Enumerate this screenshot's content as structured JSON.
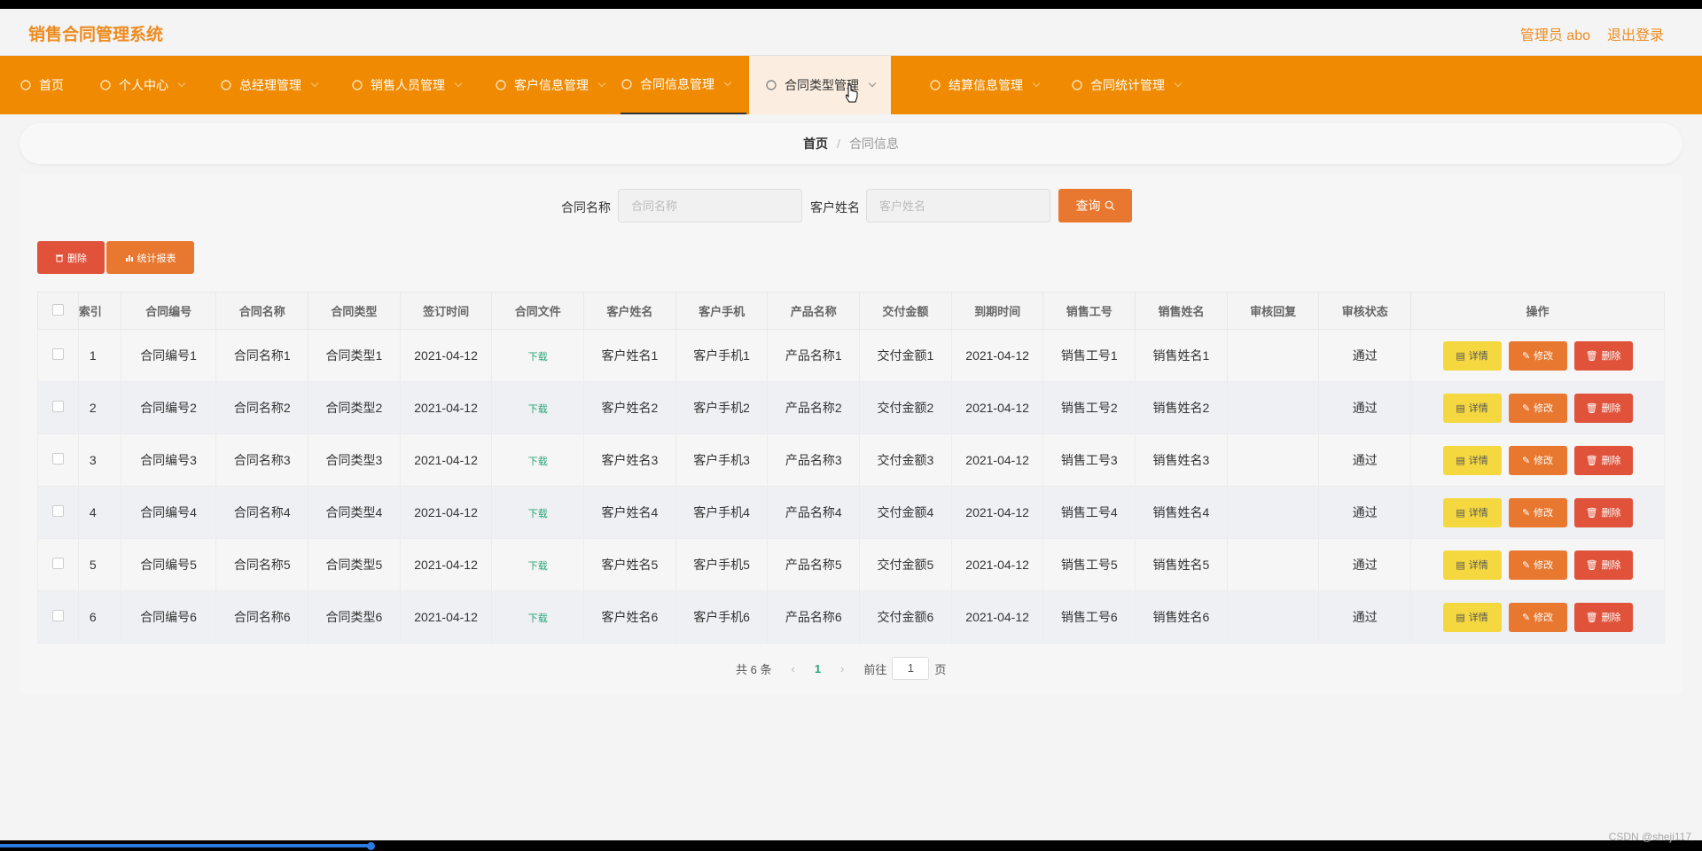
{
  "header": {
    "app_title": "销售合同管理系统",
    "admin_label": "管理员 abo",
    "logout_label": "退出登录"
  },
  "nav": {
    "items": [
      {
        "label": "首页"
      },
      {
        "label": "个人中心"
      },
      {
        "label": "总经理管理"
      },
      {
        "label": "销售人员管理"
      },
      {
        "label": "客户信息管理"
      },
      {
        "label": "合同信息管理"
      },
      {
        "label": "合同类型管理"
      },
      {
        "label": "结算信息管理"
      },
      {
        "label": "合同统计管理"
      }
    ]
  },
  "breadcrumb": {
    "home": "首页",
    "separator": "/",
    "current": "合同信息"
  },
  "search": {
    "contract_name_label": "合同名称",
    "contract_name_placeholder": "合同名称",
    "customer_name_label": "客户姓名",
    "customer_name_placeholder": "客户姓名",
    "query_label": "查询"
  },
  "actions": {
    "delete_label": "删除",
    "stats_label": "统计报表"
  },
  "table": {
    "headers": [
      "索引",
      "合同编号",
      "合同名称",
      "合同类型",
      "签订时间",
      "合同文件",
      "客户姓名",
      "客户手机",
      "产品名称",
      "交付金额",
      "到期时间",
      "销售工号",
      "销售姓名",
      "审核回复",
      "审核状态",
      "操作"
    ],
    "download_label": "下载",
    "op_detail": "详情",
    "op_edit": "修改",
    "op_delete": "删除",
    "rows": [
      {
        "idx": "1",
        "code": "合同编号1",
        "name": "合同名称1",
        "type": "合同类型1",
        "sign": "2021-04-12",
        "cust": "客户姓名1",
        "phone": "客户手机1",
        "product": "产品名称1",
        "amount": "交付金额1",
        "due": "2021-04-12",
        "sno": "销售工号1",
        "sname": "销售姓名1",
        "reply": "",
        "status": "通过"
      },
      {
        "idx": "2",
        "code": "合同编号2",
        "name": "合同名称2",
        "type": "合同类型2",
        "sign": "2021-04-12",
        "cust": "客户姓名2",
        "phone": "客户手机2",
        "product": "产品名称2",
        "amount": "交付金额2",
        "due": "2021-04-12",
        "sno": "销售工号2",
        "sname": "销售姓名2",
        "reply": "",
        "status": "通过"
      },
      {
        "idx": "3",
        "code": "合同编号3",
        "name": "合同名称3",
        "type": "合同类型3",
        "sign": "2021-04-12",
        "cust": "客户姓名3",
        "phone": "客户手机3",
        "product": "产品名称3",
        "amount": "交付金额3",
        "due": "2021-04-12",
        "sno": "销售工号3",
        "sname": "销售姓名3",
        "reply": "",
        "status": "通过"
      },
      {
        "idx": "4",
        "code": "合同编号4",
        "name": "合同名称4",
        "type": "合同类型4",
        "sign": "2021-04-12",
        "cust": "客户姓名4",
        "phone": "客户手机4",
        "product": "产品名称4",
        "amount": "交付金额4",
        "due": "2021-04-12",
        "sno": "销售工号4",
        "sname": "销售姓名4",
        "reply": "",
        "status": "通过"
      },
      {
        "idx": "5",
        "code": "合同编号5",
        "name": "合同名称5",
        "type": "合同类型5",
        "sign": "2021-04-12",
        "cust": "客户姓名5",
        "phone": "客户手机5",
        "product": "产品名称5",
        "amount": "交付金额5",
        "due": "2021-04-12",
        "sno": "销售工号5",
        "sname": "销售姓名5",
        "reply": "",
        "status": "通过"
      },
      {
        "idx": "6",
        "code": "合同编号6",
        "name": "合同名称6",
        "type": "合同类型6",
        "sign": "2021-04-12",
        "cust": "客户姓名6",
        "phone": "客户手机6",
        "product": "产品名称6",
        "amount": "交付金额6",
        "due": "2021-04-12",
        "sno": "销售工号6",
        "sname": "销售姓名6",
        "reply": "",
        "status": "通过"
      }
    ]
  },
  "pagination": {
    "total_label": "共 6 条",
    "prev_icon": "‹",
    "current_page": "1",
    "next_icon": "›",
    "goto_label": "前往",
    "goto_value": "1",
    "page_suffix": "页"
  },
  "watermark": "CSDN @sheji117",
  "colors": {
    "accent": "#f08a00",
    "query": "#e8782f",
    "delete": "#e0523a",
    "detail": "#f5d840",
    "link": "#27a577"
  },
  "icons": {
    "nav": [
      "home-icon",
      "user-icon",
      "globe-icon",
      "chat-icon",
      "send-icon",
      "mail-icon",
      "navigation-icon",
      "briefcase-icon",
      "trophy-icon"
    ]
  }
}
